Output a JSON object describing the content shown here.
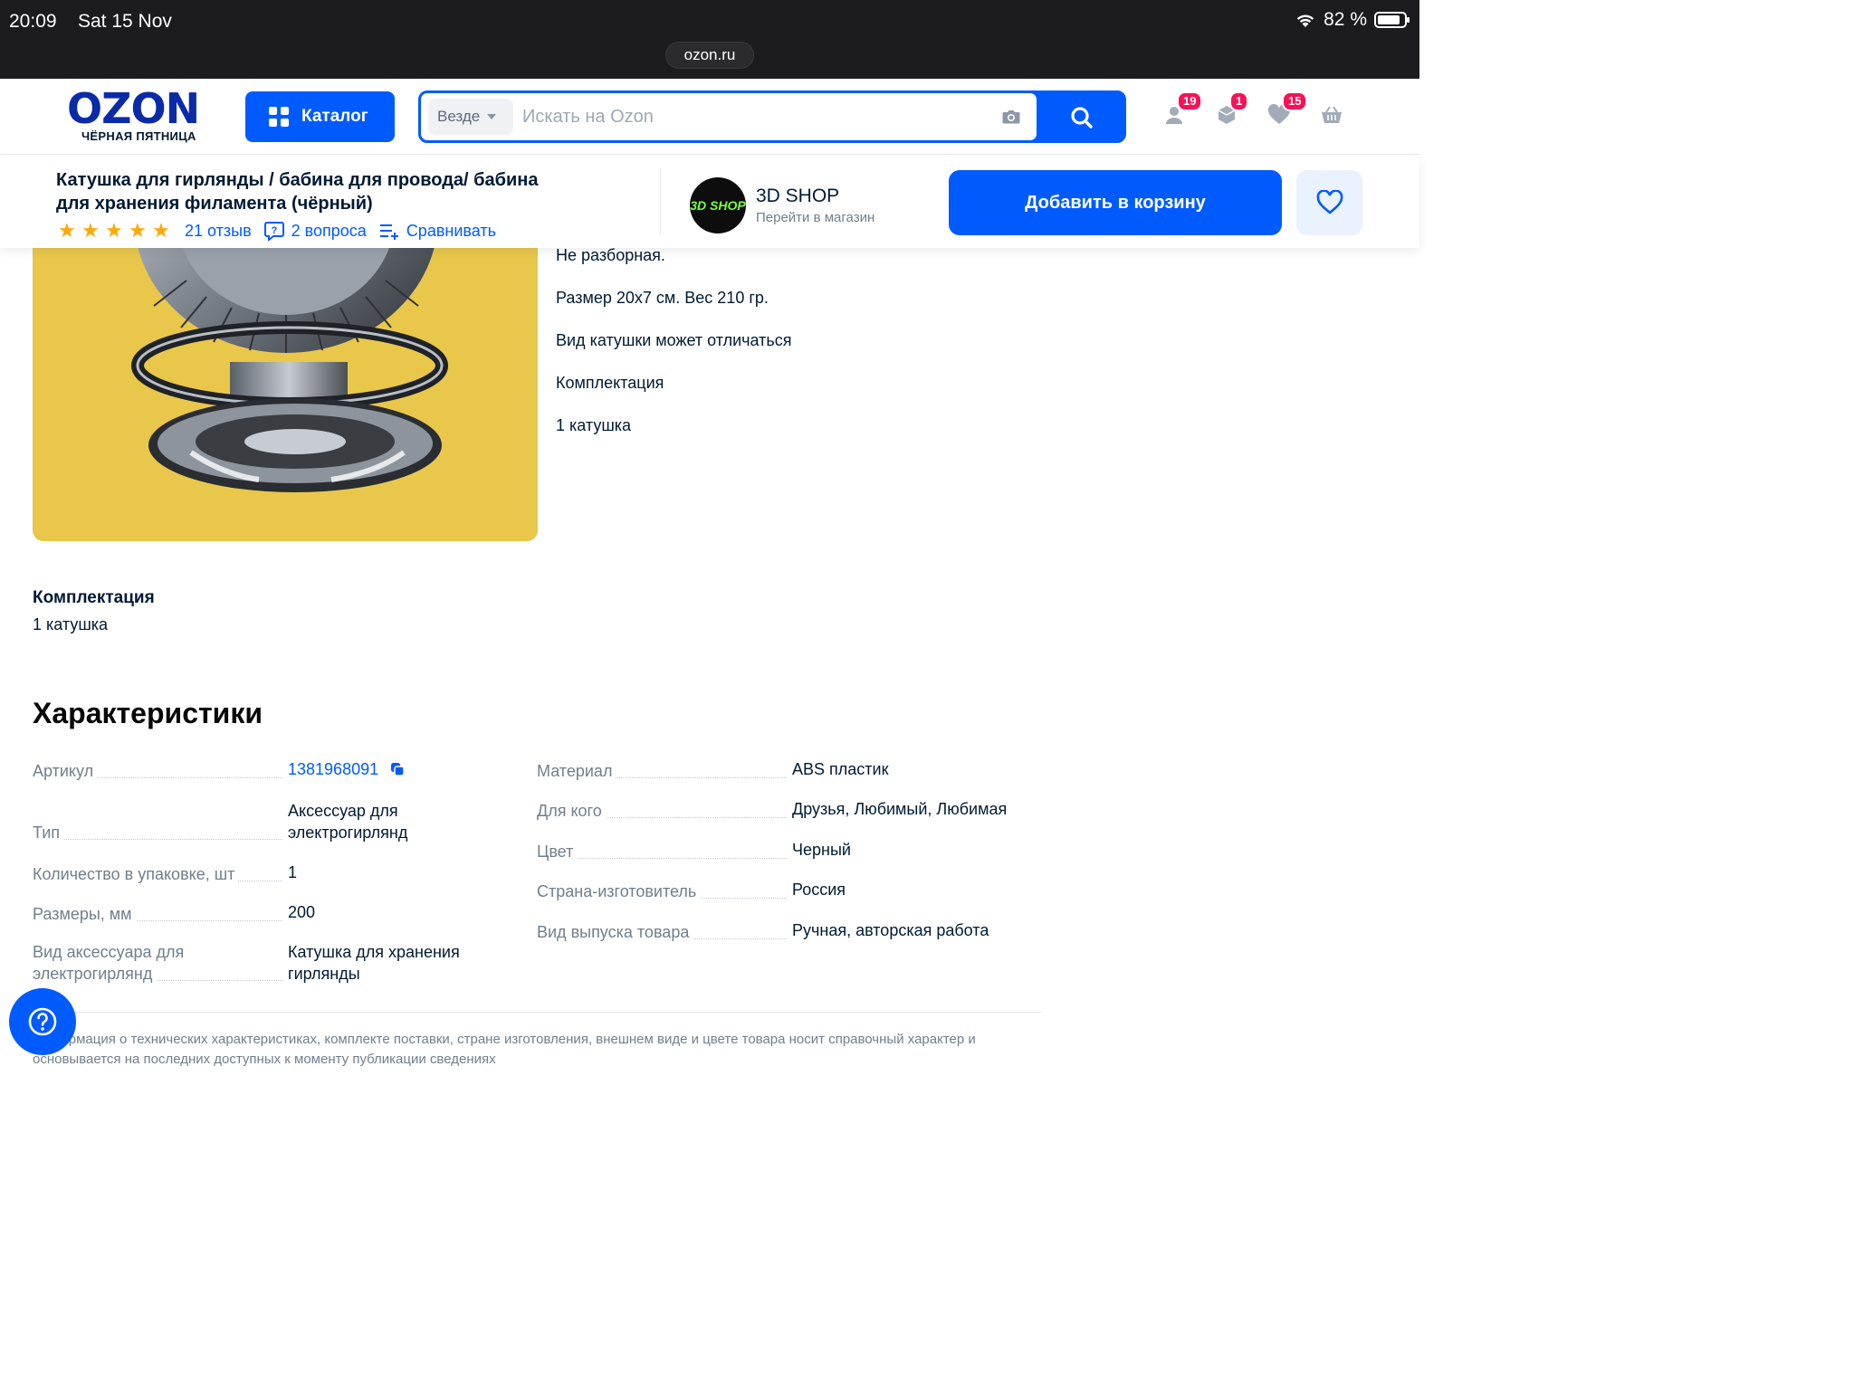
{
  "status_bar": {
    "time": "20:09",
    "date": "Sat 15 Nov",
    "battery": "82 %",
    "url": "ozon.ru"
  },
  "header": {
    "logo_text": "OZON",
    "logo_sub": "ЧЁРНАЯ ПЯТНИЦА",
    "catalog_label": "Каталог",
    "search_scope": "Везде",
    "search_placeholder": "Искать на Ozon",
    "badges": {
      "profile": "19",
      "orders": "1",
      "favorites": "15"
    }
  },
  "sticky": {
    "title": "Катушка для гирлянды / бабина для провода/ бабина для хранения филамента (чёрный)",
    "rating": 5,
    "reviews": "21 отзыв",
    "questions": "2 вопроса",
    "compare": "Сравнивать",
    "shop_logo_text": "3D SHOP",
    "shop_name": "3D SHOP",
    "shop_link": "Перейти в магазин",
    "add_to_cart": "Добавить в корзину"
  },
  "description": [
    "Не разборная.",
    "Размер 20х7 см. Вес 210 гр.",
    "Вид катушки может отличаться",
    "Комплектация",
    "1 катушка"
  ],
  "complectation": {
    "title": "Комплектация",
    "value": "1  катушка"
  },
  "characteristics": {
    "title": "Характеристики",
    "left": [
      {
        "key": "Артикул",
        "value": "1381968091"
      },
      {
        "key": "Тип",
        "value": "Аксессуар для электрогирлянд"
      },
      {
        "key": "Количество в упаковке, шт",
        "value": "1"
      },
      {
        "key": "Размеры, мм",
        "value": "200"
      },
      {
        "key": "Вид аксессуара для электрогирлянд",
        "value": "Катушка для хранения гирлянды"
      }
    ],
    "right": [
      {
        "key": "Материал",
        "value": "ABS пластик"
      },
      {
        "key": "Для кого",
        "value": "Друзья, Любимый, Любимая"
      },
      {
        "key": "Цвет",
        "value": "Черный"
      },
      {
        "key": "Страна-изготовитель",
        "value": "Россия"
      },
      {
        "key": "Вид выпуска товара",
        "value": "Ручная, авторская работа"
      }
    ],
    "disclaimer": "Информация о технических характеристиках, комплекте поставки, стране изготовления, внешнем виде и цвете товара носит справочный характер и основывается на последних доступных к моменту публикации сведениях"
  },
  "colors": {
    "accent": "#005bff",
    "badge": "#f91155",
    "star": "#ffa800",
    "image_bg": "#e9c74a"
  }
}
